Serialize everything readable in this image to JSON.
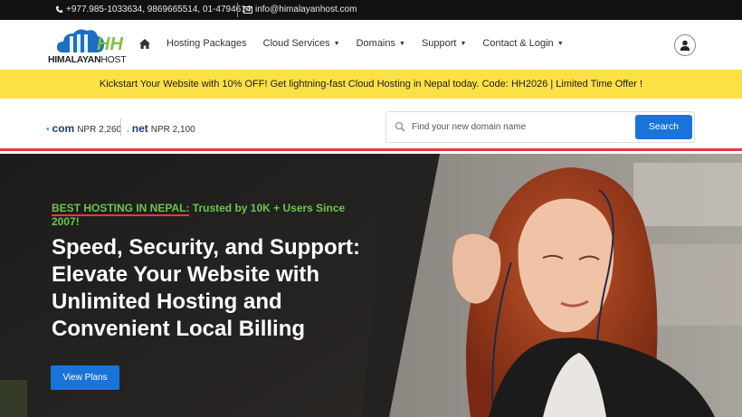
{
  "topbar": {
    "phone": "+977.985-1033634, 9869665514, 01-4794614",
    "email": "info@himalayanhost.com"
  },
  "logo": {
    "mark": "HH",
    "name_bold": "HIMALAYAN",
    "name_thin": "HOST"
  },
  "nav": {
    "home_icon": "home-icon",
    "items": [
      {
        "label": "Hosting Packages",
        "dropdown": false
      },
      {
        "label": "Cloud Services",
        "dropdown": true
      },
      {
        "label": "Domains",
        "dropdown": true
      },
      {
        "label": "Support",
        "dropdown": true
      },
      {
        "label": "Contact & Login",
        "dropdown": true
      }
    ],
    "user_icon": "user-icon"
  },
  "promo": {
    "text": "Kickstart Your Website with 10% OFF! Get lightning-fast Cloud Hosting in Nepal today. Code: HH2026 | Limited Time Offer !"
  },
  "domains": {
    "tlds": [
      {
        "ext": "com",
        "price": "NPR 2,260"
      },
      {
        "ext": "net",
        "price": "NPR 2,100"
      }
    ],
    "search": {
      "placeholder": "Find your new domain name",
      "button": "Search"
    }
  },
  "hero": {
    "tag_highlight": "BEST HOSTING IN NEPAL:",
    "tag_rest": " Trusted by 10K + Users Since 2007!",
    "headline": "Speed, Security, and Support: Elevate Your Website with Unlimited Hosting and Convenient Local Billing",
    "cta": "View Plans"
  },
  "colors": {
    "topbar_bg": "#111111",
    "promo_bg": "#fce146",
    "accent_blue": "#1a73d9",
    "accent_green": "#6bc74a",
    "accent_red": "#e23b3b"
  }
}
